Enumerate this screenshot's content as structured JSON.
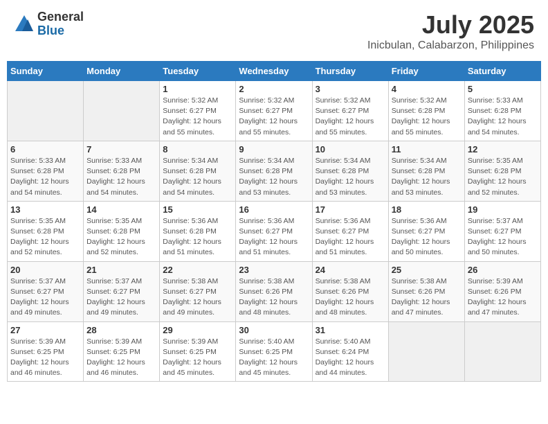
{
  "logo": {
    "general": "General",
    "blue": "Blue"
  },
  "title": "July 2025",
  "subtitle": "Inicbulan, Calabarzon, Philippines",
  "weekdays": [
    "Sunday",
    "Monday",
    "Tuesday",
    "Wednesday",
    "Thursday",
    "Friday",
    "Saturday"
  ],
  "weeks": [
    [
      {
        "day": "",
        "info": ""
      },
      {
        "day": "",
        "info": ""
      },
      {
        "day": "1",
        "info": "Sunrise: 5:32 AM\nSunset: 6:27 PM\nDaylight: 12 hours and 55 minutes."
      },
      {
        "day": "2",
        "info": "Sunrise: 5:32 AM\nSunset: 6:27 PM\nDaylight: 12 hours and 55 minutes."
      },
      {
        "day": "3",
        "info": "Sunrise: 5:32 AM\nSunset: 6:27 PM\nDaylight: 12 hours and 55 minutes."
      },
      {
        "day": "4",
        "info": "Sunrise: 5:32 AM\nSunset: 6:28 PM\nDaylight: 12 hours and 55 minutes."
      },
      {
        "day": "5",
        "info": "Sunrise: 5:33 AM\nSunset: 6:28 PM\nDaylight: 12 hours and 54 minutes."
      }
    ],
    [
      {
        "day": "6",
        "info": "Sunrise: 5:33 AM\nSunset: 6:28 PM\nDaylight: 12 hours and 54 minutes."
      },
      {
        "day": "7",
        "info": "Sunrise: 5:33 AM\nSunset: 6:28 PM\nDaylight: 12 hours and 54 minutes."
      },
      {
        "day": "8",
        "info": "Sunrise: 5:34 AM\nSunset: 6:28 PM\nDaylight: 12 hours and 54 minutes."
      },
      {
        "day": "9",
        "info": "Sunrise: 5:34 AM\nSunset: 6:28 PM\nDaylight: 12 hours and 53 minutes."
      },
      {
        "day": "10",
        "info": "Sunrise: 5:34 AM\nSunset: 6:28 PM\nDaylight: 12 hours and 53 minutes."
      },
      {
        "day": "11",
        "info": "Sunrise: 5:34 AM\nSunset: 6:28 PM\nDaylight: 12 hours and 53 minutes."
      },
      {
        "day": "12",
        "info": "Sunrise: 5:35 AM\nSunset: 6:28 PM\nDaylight: 12 hours and 52 minutes."
      }
    ],
    [
      {
        "day": "13",
        "info": "Sunrise: 5:35 AM\nSunset: 6:28 PM\nDaylight: 12 hours and 52 minutes."
      },
      {
        "day": "14",
        "info": "Sunrise: 5:35 AM\nSunset: 6:28 PM\nDaylight: 12 hours and 52 minutes."
      },
      {
        "day": "15",
        "info": "Sunrise: 5:36 AM\nSunset: 6:28 PM\nDaylight: 12 hours and 51 minutes."
      },
      {
        "day": "16",
        "info": "Sunrise: 5:36 AM\nSunset: 6:27 PM\nDaylight: 12 hours and 51 minutes."
      },
      {
        "day": "17",
        "info": "Sunrise: 5:36 AM\nSunset: 6:27 PM\nDaylight: 12 hours and 51 minutes."
      },
      {
        "day": "18",
        "info": "Sunrise: 5:36 AM\nSunset: 6:27 PM\nDaylight: 12 hours and 50 minutes."
      },
      {
        "day": "19",
        "info": "Sunrise: 5:37 AM\nSunset: 6:27 PM\nDaylight: 12 hours and 50 minutes."
      }
    ],
    [
      {
        "day": "20",
        "info": "Sunrise: 5:37 AM\nSunset: 6:27 PM\nDaylight: 12 hours and 49 minutes."
      },
      {
        "day": "21",
        "info": "Sunrise: 5:37 AM\nSunset: 6:27 PM\nDaylight: 12 hours and 49 minutes."
      },
      {
        "day": "22",
        "info": "Sunrise: 5:38 AM\nSunset: 6:27 PM\nDaylight: 12 hours and 49 minutes."
      },
      {
        "day": "23",
        "info": "Sunrise: 5:38 AM\nSunset: 6:26 PM\nDaylight: 12 hours and 48 minutes."
      },
      {
        "day": "24",
        "info": "Sunrise: 5:38 AM\nSunset: 6:26 PM\nDaylight: 12 hours and 48 minutes."
      },
      {
        "day": "25",
        "info": "Sunrise: 5:38 AM\nSunset: 6:26 PM\nDaylight: 12 hours and 47 minutes."
      },
      {
        "day": "26",
        "info": "Sunrise: 5:39 AM\nSunset: 6:26 PM\nDaylight: 12 hours and 47 minutes."
      }
    ],
    [
      {
        "day": "27",
        "info": "Sunrise: 5:39 AM\nSunset: 6:25 PM\nDaylight: 12 hours and 46 minutes."
      },
      {
        "day": "28",
        "info": "Sunrise: 5:39 AM\nSunset: 6:25 PM\nDaylight: 12 hours and 46 minutes."
      },
      {
        "day": "29",
        "info": "Sunrise: 5:39 AM\nSunset: 6:25 PM\nDaylight: 12 hours and 45 minutes."
      },
      {
        "day": "30",
        "info": "Sunrise: 5:40 AM\nSunset: 6:25 PM\nDaylight: 12 hours and 45 minutes."
      },
      {
        "day": "31",
        "info": "Sunrise: 5:40 AM\nSunset: 6:24 PM\nDaylight: 12 hours and 44 minutes."
      },
      {
        "day": "",
        "info": ""
      },
      {
        "day": "",
        "info": ""
      }
    ]
  ]
}
